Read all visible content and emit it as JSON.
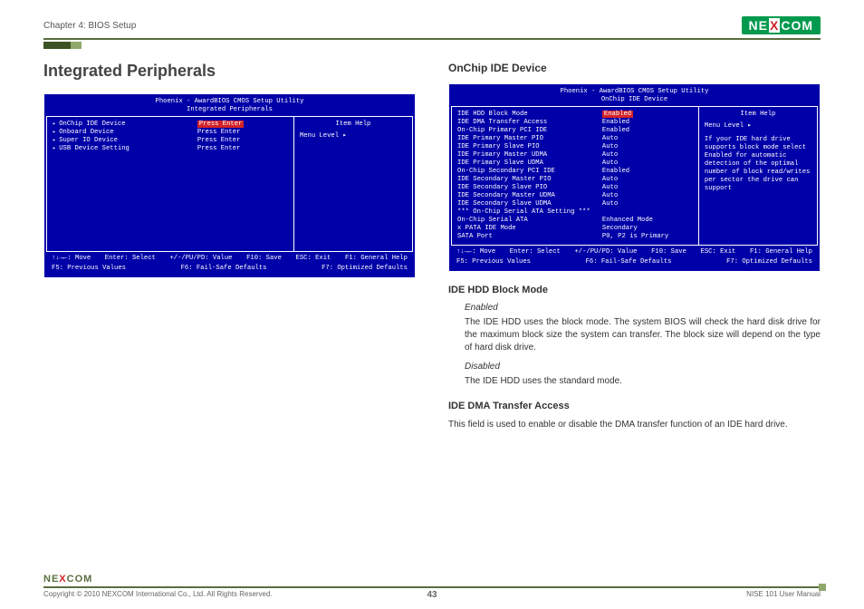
{
  "header": {
    "chapter": "Chapter 4: BIOS Setup",
    "brand_pre": "NE",
    "brand_x": "X",
    "brand_post": "COM"
  },
  "left": {
    "title": "Integrated Peripherals",
    "bios": {
      "title1": "Phoenix - AwardBIOS CMOS Setup Utility",
      "title2": "Integrated Peripherals",
      "rows": [
        {
          "label": "OnChip IDE Device",
          "value": "Press Enter",
          "tri": true,
          "hl": true
        },
        {
          "label": "Onboard Device",
          "value": "Press Enter",
          "tri": true
        },
        {
          "label": "Super IO Device",
          "value": "Press Enter",
          "tri": true
        },
        {
          "label": "USB Device Setting",
          "value": "Press Enter",
          "tri": true
        }
      ],
      "help_title": "Item Help",
      "help_body": "Menu Level     ▸",
      "footer": [
        "↑↓→←: Move",
        "Enter: Select",
        "+/-/PU/PD: Value",
        "F10: Save",
        "ESC: Exit",
        "F1: General Help",
        "F5: Previous Values",
        "F6: Fail-Safe Defaults",
        "F7: Optimized Defaults"
      ]
    }
  },
  "right": {
    "h2": "OnChip IDE Device",
    "bios": {
      "title1": "Phoenix - AwardBIOS CMOS Setup Utility",
      "title2": "OnChip IDE Device",
      "rows": [
        {
          "label": "IDE HDD Block Mode",
          "value": "Enabled",
          "hl": true
        },
        {
          "label": "IDE DMA Transfer Access",
          "value": "Enabled"
        },
        {
          "label": "On-Chip Primary PCI IDE",
          "value": "Enabled"
        },
        {
          "label": "IDE Primary Master PIO",
          "value": "Auto"
        },
        {
          "label": "IDE Primary Slave PIO",
          "value": "Auto"
        },
        {
          "label": "IDE Primary Master UDMA",
          "value": "Auto"
        },
        {
          "label": "IDE Primary Slave UDMA",
          "value": "Auto"
        },
        {
          "label": "On-Chip Secondary PCI IDE",
          "value": "Enabled"
        },
        {
          "label": "IDE Secondary Master PIO",
          "value": "Auto"
        },
        {
          "label": "IDE Secondary Slave PIO",
          "value": "Auto"
        },
        {
          "label": "IDE Secondary Master UDMA",
          "value": "Auto"
        },
        {
          "label": "IDE Secondary Slave UDMA",
          "value": "Auto"
        },
        {
          "label": "",
          "value": ""
        },
        {
          "label": "*** On-Chip Serial ATA Setting ***",
          "value": ""
        },
        {
          "label": "On-Chip Serial ATA",
          "value": "Enhanced Mode"
        },
        {
          "label": "PATA IDE Mode",
          "value": "Secondary",
          "xmark": true
        },
        {
          "label": "SATA Port",
          "value": "P0, P2 is Primary"
        }
      ],
      "help_title": "Item Help",
      "help_level": "Menu Level     ▸",
      "help_body": "If your IDE hard drive supports block mode select Enabled for automatic detection of the optimal number of block read/writes per sector the drive can support",
      "footer": [
        "↑↓→←: Move",
        "Enter: Select",
        "+/-/PU/PD: Value",
        "F10: Save",
        "ESC: Exit",
        "F1: General Help",
        "F5: Previous Values",
        "F6: Fail-Safe Defaults",
        "F7: Optimized Defaults"
      ]
    },
    "sections": {
      "s1_title": "IDE HDD Block Mode",
      "s1_enabled_label": "Enabled",
      "s1_enabled_text": "The IDE HDD uses the block mode. The system BIOS will check the hard disk drive for the maximum block size the system can transfer. The block size will depend on the type of hard disk drive.",
      "s1_disabled_label": "Disabled",
      "s1_disabled_text": "The IDE HDD uses the standard mode.",
      "s2_title": "IDE DMA Transfer Access",
      "s2_text": "This field is used to enable or disable the DMA transfer function of an IDE hard drive."
    }
  },
  "footer": {
    "copyright": "Copyright © 2010 NEXCOM International Co., Ltd. All Rights Reserved.",
    "page": "43",
    "manual": "NISE 101 User Manual"
  }
}
